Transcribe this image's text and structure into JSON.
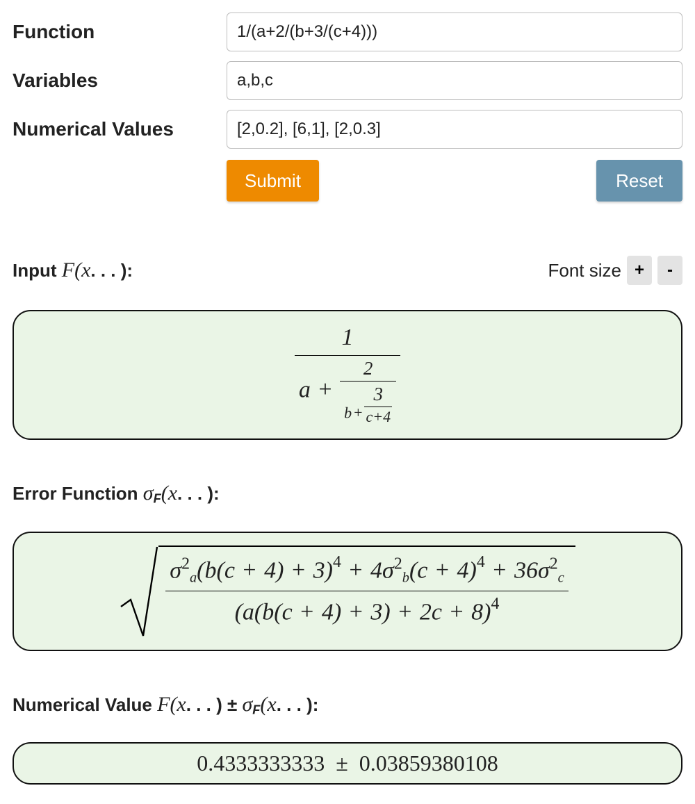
{
  "form": {
    "function_label": "Function",
    "function_value": "1/(a+2/(b+3/(c+4)))",
    "variables_label": "Variables",
    "variables_value": "a,b,c",
    "numvals_label": "Numerical Values",
    "numvals_value": "[2,0.2], [6,1], [2,0.3]",
    "submit_label": "Submit",
    "reset_label": "Reset"
  },
  "sections": {
    "input_title_prefix": "Input ",
    "error_title_prefix": "Error Function ",
    "numeric_title_prefix": "Numerical Value ",
    "font_size_label": "Font size",
    "plus": "+",
    "minus": "-"
  },
  "math": {
    "input_formula_plain": "1 / ( a + 2 / ( b + 3/(c+4) ) )",
    "a": "a",
    "b": "b",
    "c": "c",
    "one": "1",
    "two": "2",
    "three": "3",
    "cplus4": "c+4",
    "error_formula_plain": "sqrt( ( sigma_a^2 (b(c+4)+3)^4 + 4 sigma_b^2 (c+4)^4 + 36 sigma_c^2 ) / ( a(b(c+4)+3) + 2c + 8 )^4 )",
    "err_num": "σ_a^2 (b(c+4)+3)^4 + 4σ_b^2 (c+4)^4 + 36σ_c^2",
    "err_den": "(a(b(c+4)+3) + 2c + 8)^4",
    "numeric_value": "0.4333333333",
    "numeric_error": "0.03859380108"
  }
}
